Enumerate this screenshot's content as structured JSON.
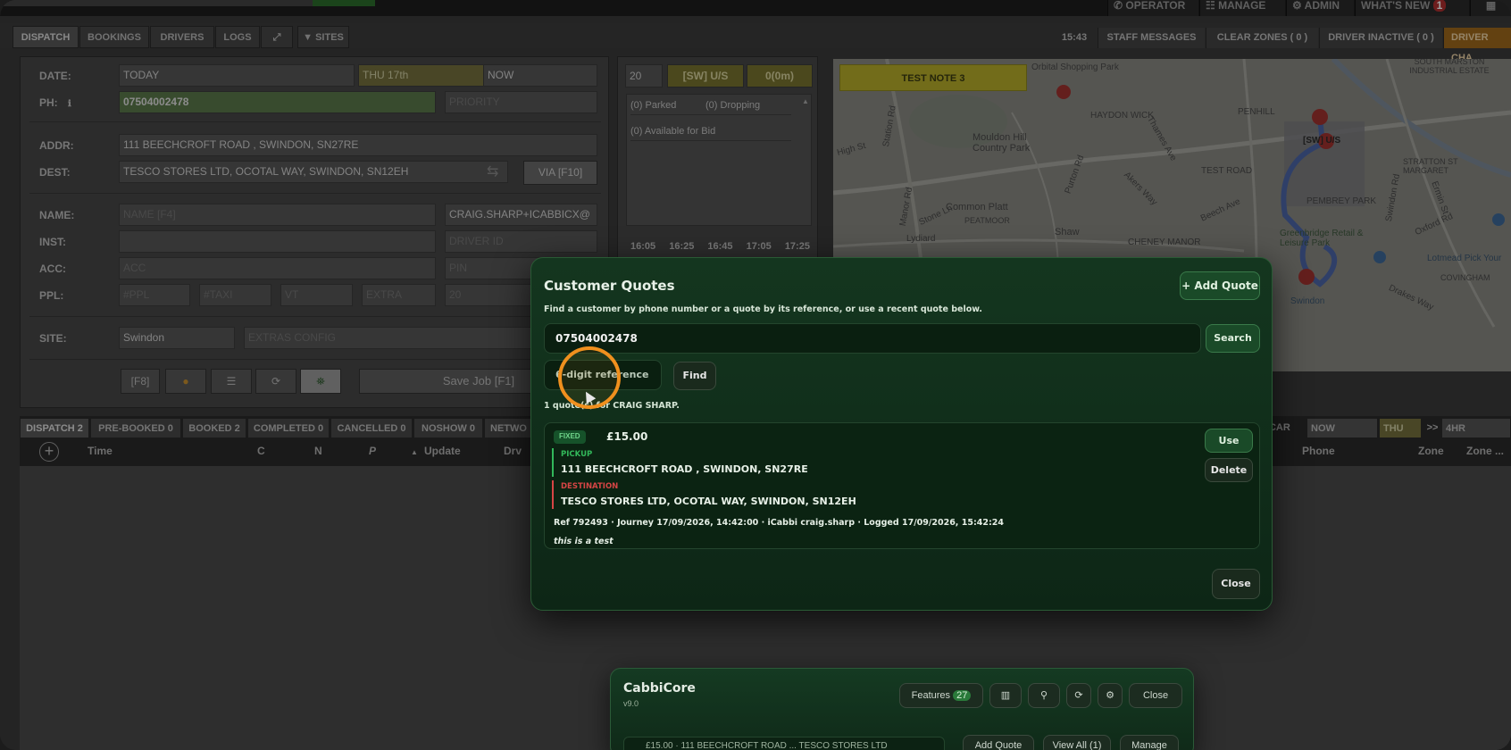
{
  "topnav": {
    "operator": "OPERATOR",
    "manage": "MANAGE",
    "admin": "ADMIN",
    "whats_new": "WHAT'S NEW",
    "notif_count": "1"
  },
  "tabs": {
    "dispatch": "DISPATCH",
    "bookings": "BOOKINGS",
    "drivers": "DRIVERS",
    "logs": "LOGS",
    "sites": "SITES"
  },
  "rightbar": {
    "time": "15:43",
    "staff_messages": "STAFF MESSAGES",
    "clear_zones": "CLEAR ZONES ( 0 )",
    "driver_inactive": "DRIVER INACTIVE ( 0 )",
    "driver_cha": "DRIVER CHA"
  },
  "form": {
    "date_label": "DATE:",
    "date_value": "TODAY",
    "date_day": "THU 17th",
    "date_time": "NOW",
    "ph_label": "PH:",
    "ph_value": "07504002478",
    "priority_placeholder": "PRIORITY",
    "addr_label": "ADDR:",
    "addr_value": "111 BEECHCROFT ROAD , SWINDON, SN27RE",
    "dest_label": "DEST:",
    "dest_value": "TESCO STORES LTD, OCOTAL WAY, SWINDON, SN12EH",
    "via_label": "VIA [F10]",
    "name_label": "NAME:",
    "name_placeholder": "NAME [F4]",
    "name_email": "CRAIG.SHARP+ICABBICX@",
    "inst_label": "INST:",
    "driver_id_placeholder": "DRIVER ID",
    "acc_label": "ACC:",
    "acc_placeholder": "ACC",
    "pin_placeholder": "PIN",
    "ppl_label": "PPL:",
    "ppl_placeholder": "#PPL",
    "taxi_placeholder": "#TAXI",
    "vt_placeholder": "VT",
    "extra_placeholder": "EXTRA",
    "ppl_num": "20",
    "site_label": "SITE:",
    "site_value": "Swindon",
    "extras_placeholder": "EXTRAS CONFIG",
    "f8_label": "[F8]",
    "save_label": "Save Job [F1]"
  },
  "mid": {
    "count": "20",
    "zone": "[SW] U/S",
    "time_zero": "0(0m)",
    "parked": "(0) Parked",
    "dropping": "(0) Dropping",
    "available": "(0) Available for Bid",
    "times": [
      "16:05",
      "16:25",
      "16:45",
      "17:05",
      "17:25"
    ]
  },
  "map": {
    "note": "TEST NOTE 3",
    "labels": [
      "Orbital Shopping Park",
      "HAYDON WICK",
      "PENHILL",
      "Mouldon Hill Country Park",
      "Common Platt",
      "PEATMOOR",
      "CHENEY MANOR",
      "Shaw",
      "Lydiard",
      "TEST ROAD",
      "[SW] U/S",
      "PEMBREY PARK",
      "SOUTH MARSTON INDUSTRIAL ESTATE",
      "STRATTON ST MARGARET",
      "Greenbridge Retail & Leisure Park",
      "Lotmead Pick Your",
      "COVINGHAM",
      "Swindon",
      "Beech Ave",
      "Akers Way",
      "Purton Rd",
      "Stone Ln",
      "Station Rd",
      "Thames Ave",
      "Ermin St",
      "Oxford Rd",
      "Drakes Way",
      "Swindon Rd",
      "High St",
      "Manor Rd"
    ]
  },
  "bottom": {
    "tabs": [
      "DISPATCH 2",
      "PRE-BOOKED 0",
      "BOOKED 2",
      "COMPLETED 0",
      "CANCELLED 0",
      "NOSHOW 0",
      "NETWO"
    ],
    "cols": [
      "Time",
      "C",
      "N",
      "P",
      "Update",
      "Drv"
    ],
    "right_cols": [
      "Phone",
      "Zone",
      "Zone ..."
    ],
    "car": "T CAR",
    "now": "NOW",
    "thu": "THU",
    "arrows": ">>",
    "hr": "4HR"
  },
  "modal": {
    "title": "Customer Quotes",
    "add_quote": "+ Add Quote",
    "subtitle": "Find a customer by phone number or a quote by its reference, or use a recent quote below.",
    "phone_value": "07504002478",
    "search_label": "Search",
    "ref_placeholder": "6-digit reference",
    "find_label": "Find",
    "result_text": "1 quote(s) for CRAIG SHARP.",
    "quote": {
      "badge": "FIXED",
      "price": "£15.00",
      "pickup_label": "PICKUP",
      "pickup": "111 BEECHCROFT ROAD , SWINDON, SN27RE",
      "dest_label": "DESTINATION",
      "dest": "TESCO STORES LTD, OCOTAL WAY, SWINDON, SN12EH",
      "meta": "Ref 792493 · Journey 17/09/2026, 14:42:00 · iCabbi craig.sharp · Logged 17/09/2026, 15:42:24",
      "note": "this is a test",
      "use_label": "Use",
      "delete_label": "Delete"
    },
    "close_label": "Close"
  },
  "cabbicore": {
    "title": "CabbiCore",
    "version": "v9.0",
    "features_label": "Features",
    "features_count": "27",
    "close_label": "Close",
    "row_text": "£15.00 · 111 BEECHCROFT ROAD ... TESCO STORES LTD",
    "add_quote": "Add Quote",
    "view_all": "View All (1)",
    "manage": "Manage"
  },
  "colors": {
    "modal_bg": "#14361f",
    "accent_green": "#2fa44f",
    "pickup_green": "#32b85a",
    "dest_red": "#d64545",
    "cursor_ring": "#f0901e",
    "note_yellow": "#c9c02a"
  }
}
